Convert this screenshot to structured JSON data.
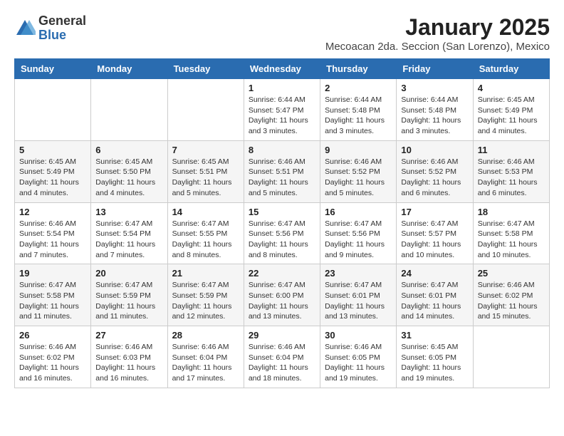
{
  "header": {
    "logo_general": "General",
    "logo_blue": "Blue",
    "title": "January 2025",
    "subtitle": "Mecoacan 2da. Seccion (San Lorenzo), Mexico"
  },
  "days_of_week": [
    "Sunday",
    "Monday",
    "Tuesday",
    "Wednesday",
    "Thursday",
    "Friday",
    "Saturday"
  ],
  "weeks": [
    [
      {
        "day": "",
        "info": ""
      },
      {
        "day": "",
        "info": ""
      },
      {
        "day": "",
        "info": ""
      },
      {
        "day": "1",
        "info": "Sunrise: 6:44 AM\nSunset: 5:47 PM\nDaylight: 11 hours and 3 minutes."
      },
      {
        "day": "2",
        "info": "Sunrise: 6:44 AM\nSunset: 5:48 PM\nDaylight: 11 hours and 3 minutes."
      },
      {
        "day": "3",
        "info": "Sunrise: 6:44 AM\nSunset: 5:48 PM\nDaylight: 11 hours and 3 minutes."
      },
      {
        "day": "4",
        "info": "Sunrise: 6:45 AM\nSunset: 5:49 PM\nDaylight: 11 hours and 4 minutes."
      }
    ],
    [
      {
        "day": "5",
        "info": "Sunrise: 6:45 AM\nSunset: 5:49 PM\nDaylight: 11 hours and 4 minutes."
      },
      {
        "day": "6",
        "info": "Sunrise: 6:45 AM\nSunset: 5:50 PM\nDaylight: 11 hours and 4 minutes."
      },
      {
        "day": "7",
        "info": "Sunrise: 6:45 AM\nSunset: 5:51 PM\nDaylight: 11 hours and 5 minutes."
      },
      {
        "day": "8",
        "info": "Sunrise: 6:46 AM\nSunset: 5:51 PM\nDaylight: 11 hours and 5 minutes."
      },
      {
        "day": "9",
        "info": "Sunrise: 6:46 AM\nSunset: 5:52 PM\nDaylight: 11 hours and 5 minutes."
      },
      {
        "day": "10",
        "info": "Sunrise: 6:46 AM\nSunset: 5:52 PM\nDaylight: 11 hours and 6 minutes."
      },
      {
        "day": "11",
        "info": "Sunrise: 6:46 AM\nSunset: 5:53 PM\nDaylight: 11 hours and 6 minutes."
      }
    ],
    [
      {
        "day": "12",
        "info": "Sunrise: 6:46 AM\nSunset: 5:54 PM\nDaylight: 11 hours and 7 minutes."
      },
      {
        "day": "13",
        "info": "Sunrise: 6:47 AM\nSunset: 5:54 PM\nDaylight: 11 hours and 7 minutes."
      },
      {
        "day": "14",
        "info": "Sunrise: 6:47 AM\nSunset: 5:55 PM\nDaylight: 11 hours and 8 minutes."
      },
      {
        "day": "15",
        "info": "Sunrise: 6:47 AM\nSunset: 5:56 PM\nDaylight: 11 hours and 8 minutes."
      },
      {
        "day": "16",
        "info": "Sunrise: 6:47 AM\nSunset: 5:56 PM\nDaylight: 11 hours and 9 minutes."
      },
      {
        "day": "17",
        "info": "Sunrise: 6:47 AM\nSunset: 5:57 PM\nDaylight: 11 hours and 10 minutes."
      },
      {
        "day": "18",
        "info": "Sunrise: 6:47 AM\nSunset: 5:58 PM\nDaylight: 11 hours and 10 minutes."
      }
    ],
    [
      {
        "day": "19",
        "info": "Sunrise: 6:47 AM\nSunset: 5:58 PM\nDaylight: 11 hours and 11 minutes."
      },
      {
        "day": "20",
        "info": "Sunrise: 6:47 AM\nSunset: 5:59 PM\nDaylight: 11 hours and 11 minutes."
      },
      {
        "day": "21",
        "info": "Sunrise: 6:47 AM\nSunset: 5:59 PM\nDaylight: 11 hours and 12 minutes."
      },
      {
        "day": "22",
        "info": "Sunrise: 6:47 AM\nSunset: 6:00 PM\nDaylight: 11 hours and 13 minutes."
      },
      {
        "day": "23",
        "info": "Sunrise: 6:47 AM\nSunset: 6:01 PM\nDaylight: 11 hours and 13 minutes."
      },
      {
        "day": "24",
        "info": "Sunrise: 6:47 AM\nSunset: 6:01 PM\nDaylight: 11 hours and 14 minutes."
      },
      {
        "day": "25",
        "info": "Sunrise: 6:46 AM\nSunset: 6:02 PM\nDaylight: 11 hours and 15 minutes."
      }
    ],
    [
      {
        "day": "26",
        "info": "Sunrise: 6:46 AM\nSunset: 6:02 PM\nDaylight: 11 hours and 16 minutes."
      },
      {
        "day": "27",
        "info": "Sunrise: 6:46 AM\nSunset: 6:03 PM\nDaylight: 11 hours and 16 minutes."
      },
      {
        "day": "28",
        "info": "Sunrise: 6:46 AM\nSunset: 6:04 PM\nDaylight: 11 hours and 17 minutes."
      },
      {
        "day": "29",
        "info": "Sunrise: 6:46 AM\nSunset: 6:04 PM\nDaylight: 11 hours and 18 minutes."
      },
      {
        "day": "30",
        "info": "Sunrise: 6:46 AM\nSunset: 6:05 PM\nDaylight: 11 hours and 19 minutes."
      },
      {
        "day": "31",
        "info": "Sunrise: 6:45 AM\nSunset: 6:05 PM\nDaylight: 11 hours and 19 minutes."
      },
      {
        "day": "",
        "info": ""
      }
    ]
  ]
}
